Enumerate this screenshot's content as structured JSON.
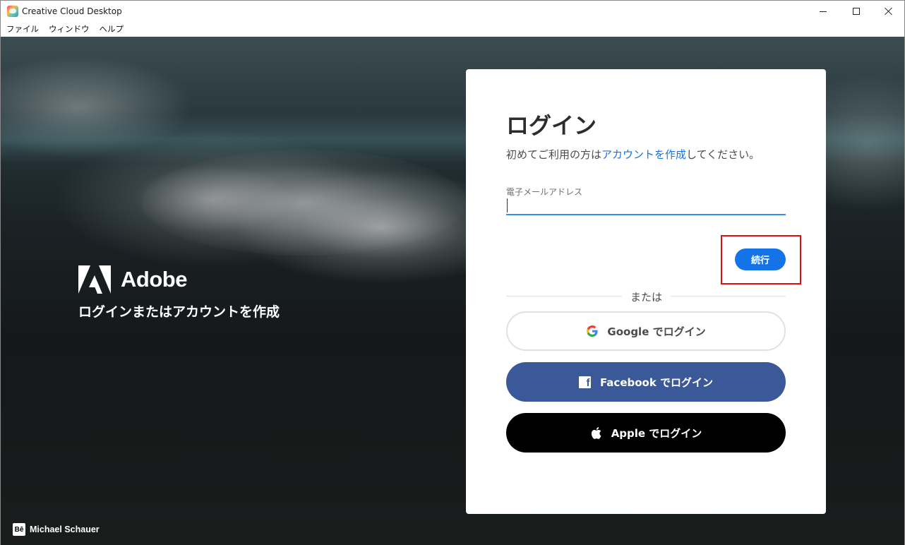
{
  "window": {
    "title": "Creative Cloud Desktop",
    "menu": [
      "ファイル",
      "ウィンドウ",
      "ヘルプ"
    ]
  },
  "brand": {
    "name": "Adobe",
    "tagline": "ログインまたはアカウントを作成"
  },
  "credit": {
    "icon_text": "Bē",
    "name": "Michael Schauer"
  },
  "login": {
    "title": "ログイン",
    "subtitle_prefix": "初めてご利用の方は",
    "subtitle_link": "アカウントを作成",
    "subtitle_suffix": "してください。",
    "email_label": "電子メールアドレス",
    "email_value": "",
    "continue_label": "続行",
    "or_text": "または",
    "google_label": "Google でログイン",
    "facebook_label": "Facebook でログイン",
    "apple_label": "Apple でログイン"
  },
  "colors": {
    "accent": "#1473e6",
    "facebook": "#3b5998",
    "apple": "#000000",
    "highlight": "#e01010"
  }
}
